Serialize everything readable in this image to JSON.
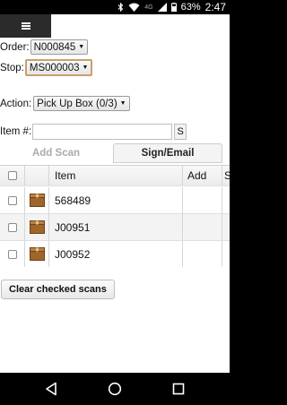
{
  "status_bar": {
    "battery_percent": "63%",
    "time": "2:47",
    "network": "4G"
  },
  "form": {
    "order_label": "Order:",
    "order_value": "N000845",
    "stop_label": "Stop:",
    "stop_value": "MS000003",
    "action_label": "Action:",
    "action_value": "Pick Up Box (0/3)",
    "item_label": "Item #:",
    "item_value": "",
    "s_button_label": "S"
  },
  "tabs": {
    "add_scan": "Add Scan",
    "sign_email": "Sign/Email"
  },
  "grid": {
    "headers": {
      "item": "Item",
      "add": "Add",
      "more": "S"
    },
    "rows": [
      {
        "item": "568489"
      },
      {
        "item": "J00951"
      },
      {
        "item": "J00952"
      }
    ]
  },
  "buttons": {
    "clear_checked": "Clear checked scans"
  },
  "colors": {
    "menu_bg": "#2b2b2b",
    "box_brown": "#a0652a",
    "active_select_border": "#c9a06a"
  }
}
